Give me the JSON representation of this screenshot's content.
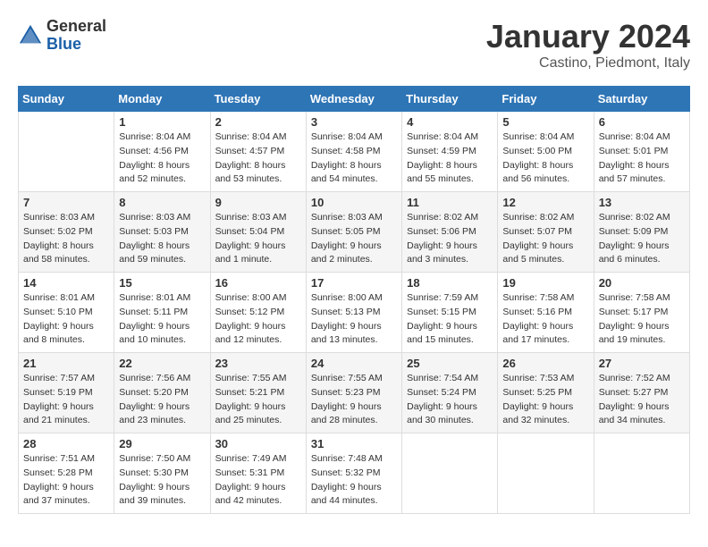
{
  "header": {
    "logo_general": "General",
    "logo_blue": "Blue",
    "month_title": "January 2024",
    "subtitle": "Castino, Piedmont, Italy"
  },
  "days_of_week": [
    "Sunday",
    "Monday",
    "Tuesday",
    "Wednesday",
    "Thursday",
    "Friday",
    "Saturday"
  ],
  "weeks": [
    [
      {
        "day": "",
        "sunrise": "",
        "sunset": "",
        "daylight": ""
      },
      {
        "day": "1",
        "sunrise": "Sunrise: 8:04 AM",
        "sunset": "Sunset: 4:56 PM",
        "daylight": "Daylight: 8 hours and 52 minutes."
      },
      {
        "day": "2",
        "sunrise": "Sunrise: 8:04 AM",
        "sunset": "Sunset: 4:57 PM",
        "daylight": "Daylight: 8 hours and 53 minutes."
      },
      {
        "day": "3",
        "sunrise": "Sunrise: 8:04 AM",
        "sunset": "Sunset: 4:58 PM",
        "daylight": "Daylight: 8 hours and 54 minutes."
      },
      {
        "day": "4",
        "sunrise": "Sunrise: 8:04 AM",
        "sunset": "Sunset: 4:59 PM",
        "daylight": "Daylight: 8 hours and 55 minutes."
      },
      {
        "day": "5",
        "sunrise": "Sunrise: 8:04 AM",
        "sunset": "Sunset: 5:00 PM",
        "daylight": "Daylight: 8 hours and 56 minutes."
      },
      {
        "day": "6",
        "sunrise": "Sunrise: 8:04 AM",
        "sunset": "Sunset: 5:01 PM",
        "daylight": "Daylight: 8 hours and 57 minutes."
      }
    ],
    [
      {
        "day": "7",
        "sunrise": "Sunrise: 8:03 AM",
        "sunset": "Sunset: 5:02 PM",
        "daylight": "Daylight: 8 hours and 58 minutes."
      },
      {
        "day": "8",
        "sunrise": "Sunrise: 8:03 AM",
        "sunset": "Sunset: 5:03 PM",
        "daylight": "Daylight: 8 hours and 59 minutes."
      },
      {
        "day": "9",
        "sunrise": "Sunrise: 8:03 AM",
        "sunset": "Sunset: 5:04 PM",
        "daylight": "Daylight: 9 hours and 1 minute."
      },
      {
        "day": "10",
        "sunrise": "Sunrise: 8:03 AM",
        "sunset": "Sunset: 5:05 PM",
        "daylight": "Daylight: 9 hours and 2 minutes."
      },
      {
        "day": "11",
        "sunrise": "Sunrise: 8:02 AM",
        "sunset": "Sunset: 5:06 PM",
        "daylight": "Daylight: 9 hours and 3 minutes."
      },
      {
        "day": "12",
        "sunrise": "Sunrise: 8:02 AM",
        "sunset": "Sunset: 5:07 PM",
        "daylight": "Daylight: 9 hours and 5 minutes."
      },
      {
        "day": "13",
        "sunrise": "Sunrise: 8:02 AM",
        "sunset": "Sunset: 5:09 PM",
        "daylight": "Daylight: 9 hours and 6 minutes."
      }
    ],
    [
      {
        "day": "14",
        "sunrise": "Sunrise: 8:01 AM",
        "sunset": "Sunset: 5:10 PM",
        "daylight": "Daylight: 9 hours and 8 minutes."
      },
      {
        "day": "15",
        "sunrise": "Sunrise: 8:01 AM",
        "sunset": "Sunset: 5:11 PM",
        "daylight": "Daylight: 9 hours and 10 minutes."
      },
      {
        "day": "16",
        "sunrise": "Sunrise: 8:00 AM",
        "sunset": "Sunset: 5:12 PM",
        "daylight": "Daylight: 9 hours and 12 minutes."
      },
      {
        "day": "17",
        "sunrise": "Sunrise: 8:00 AM",
        "sunset": "Sunset: 5:13 PM",
        "daylight": "Daylight: 9 hours and 13 minutes."
      },
      {
        "day": "18",
        "sunrise": "Sunrise: 7:59 AM",
        "sunset": "Sunset: 5:15 PM",
        "daylight": "Daylight: 9 hours and 15 minutes."
      },
      {
        "day": "19",
        "sunrise": "Sunrise: 7:58 AM",
        "sunset": "Sunset: 5:16 PM",
        "daylight": "Daylight: 9 hours and 17 minutes."
      },
      {
        "day": "20",
        "sunrise": "Sunrise: 7:58 AM",
        "sunset": "Sunset: 5:17 PM",
        "daylight": "Daylight: 9 hours and 19 minutes."
      }
    ],
    [
      {
        "day": "21",
        "sunrise": "Sunrise: 7:57 AM",
        "sunset": "Sunset: 5:19 PM",
        "daylight": "Daylight: 9 hours and 21 minutes."
      },
      {
        "day": "22",
        "sunrise": "Sunrise: 7:56 AM",
        "sunset": "Sunset: 5:20 PM",
        "daylight": "Daylight: 9 hours and 23 minutes."
      },
      {
        "day": "23",
        "sunrise": "Sunrise: 7:55 AM",
        "sunset": "Sunset: 5:21 PM",
        "daylight": "Daylight: 9 hours and 25 minutes."
      },
      {
        "day": "24",
        "sunrise": "Sunrise: 7:55 AM",
        "sunset": "Sunset: 5:23 PM",
        "daylight": "Daylight: 9 hours and 28 minutes."
      },
      {
        "day": "25",
        "sunrise": "Sunrise: 7:54 AM",
        "sunset": "Sunset: 5:24 PM",
        "daylight": "Daylight: 9 hours and 30 minutes."
      },
      {
        "day": "26",
        "sunrise": "Sunrise: 7:53 AM",
        "sunset": "Sunset: 5:25 PM",
        "daylight": "Daylight: 9 hours and 32 minutes."
      },
      {
        "day": "27",
        "sunrise": "Sunrise: 7:52 AM",
        "sunset": "Sunset: 5:27 PM",
        "daylight": "Daylight: 9 hours and 34 minutes."
      }
    ],
    [
      {
        "day": "28",
        "sunrise": "Sunrise: 7:51 AM",
        "sunset": "Sunset: 5:28 PM",
        "daylight": "Daylight: 9 hours and 37 minutes."
      },
      {
        "day": "29",
        "sunrise": "Sunrise: 7:50 AM",
        "sunset": "Sunset: 5:30 PM",
        "daylight": "Daylight: 9 hours and 39 minutes."
      },
      {
        "day": "30",
        "sunrise": "Sunrise: 7:49 AM",
        "sunset": "Sunset: 5:31 PM",
        "daylight": "Daylight: 9 hours and 42 minutes."
      },
      {
        "day": "31",
        "sunrise": "Sunrise: 7:48 AM",
        "sunset": "Sunset: 5:32 PM",
        "daylight": "Daylight: 9 hours and 44 minutes."
      },
      {
        "day": "",
        "sunrise": "",
        "sunset": "",
        "daylight": ""
      },
      {
        "day": "",
        "sunrise": "",
        "sunset": "",
        "daylight": ""
      },
      {
        "day": "",
        "sunrise": "",
        "sunset": "",
        "daylight": ""
      }
    ]
  ]
}
